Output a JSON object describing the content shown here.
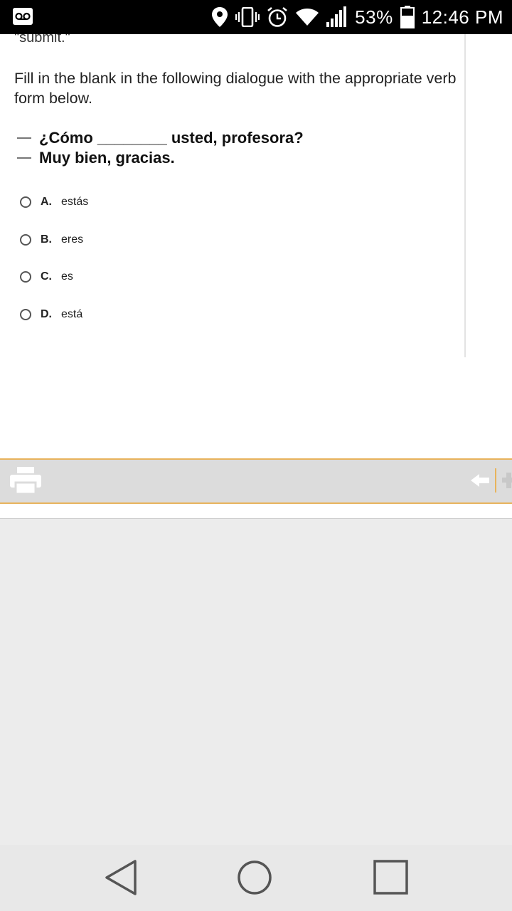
{
  "status_bar": {
    "battery_percent": "53%",
    "time": "12:46 PM",
    "icons": [
      "voicemail-icon",
      "location-icon",
      "vibrate-icon",
      "alarm-icon",
      "wifi-icon",
      "signal-icon",
      "battery-icon"
    ]
  },
  "question": {
    "cut_off_text": "\"submit.\"",
    "instruction": "Fill in the blank in the following dialogue with the appropriate verb form below.",
    "dialogue": [
      "¿Cómo ________ usted, profesora?",
      "Muy bien, gracias."
    ],
    "options": [
      {
        "letter": "A.",
        "text": "estás"
      },
      {
        "letter": "B.",
        "text": "eres"
      },
      {
        "letter": "C.",
        "text": "es"
      },
      {
        "letter": "D.",
        "text": "está"
      }
    ]
  },
  "toolbar": {
    "icons": [
      "print-icon",
      "back-arrow-icon",
      "plus-icon"
    ]
  },
  "nav_bar": {
    "icons": [
      "back-triangle-icon",
      "home-circle-icon",
      "recents-square-icon"
    ]
  },
  "colors": {
    "toolbar_bg": "#dcdcdc",
    "toolbar_accent": "#e8b35c",
    "status_bar_bg": "#000000",
    "nav_bar_bg": "#e8e8e8"
  }
}
